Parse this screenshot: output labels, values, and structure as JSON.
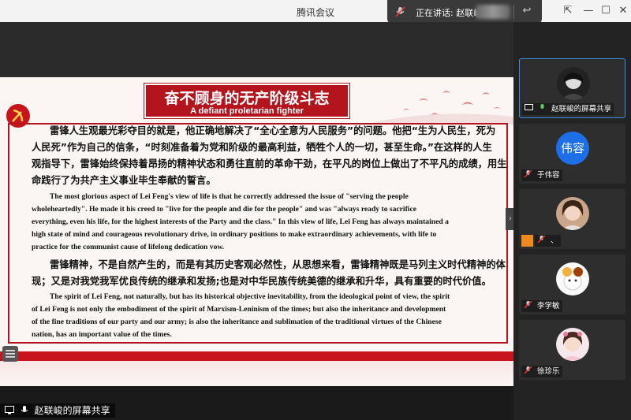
{
  "window": {
    "title": "腾讯会议"
  },
  "speaking": {
    "label": "正在讲话: 赵联峻"
  },
  "slide": {
    "title_zh": "奋不顾身的无产阶级斗志",
    "title_en": "A defiant proletarian fighter",
    "zh_para1": [
      "雷锋人生观最光彩夺目的就是，他正确地解决了“全心全意为人民服务”的问题。他把“生为人民生，死为",
      "人民死”作为自己的信条，“时刻准备着为党和阶级的最高利益，牺牲个人的一切，甚至生命。”在这样的人生",
      "观指导下，雷锋始终保持着昂扬的精神状态和勇往直前的革命干劲，在平凡的岗位上做出了不平凡的成绩，用生",
      "命践行了为共产主义事业毕生奉献的誓言。"
    ],
    "en_para1": [
      "The most glorious aspect of Lei Feng's view of life is that he correctly addressed the issue of \"serving the people",
      "wholeheartedly\". He made it his creed to \"live for the people and die for the people\" and was \"always ready to sacrifice",
      "everything, even his life, for the highest interests of the Party and the class.\" In this view of life, Lei Feng has always maintained a",
      "high state of mind and courageous revolutionary drive, in ordinary positions to make extraordinary achievements, with life to",
      "practice for the communist cause of lifelong dedication vow."
    ],
    "zh_para2": [
      "雷锋精神，不是自然产生的，而是有其历史客观必然性，从思想来看，雷锋精神既是马列主义时代精神的体",
      "现；又是对我党我军优良传统的继承和发扬;也是对中华民族传统美德的继承和升华，具有重要的时代价值。"
    ],
    "en_para2": [
      "The spirit of Lei Feng, not naturally, but has its historical objective inevitability, from the ideological point of view, the spirit",
      "of Lei Feng is not only the embodiment of the spirit of Marxism-Leninism of the times; but also the inheritance and development",
      "of the fine traditions of our party and our army; is also the inheritance and sublimation of the traditional virtues of the Chinese",
      "nation, has an important value of the times."
    ]
  },
  "share_label": "赵联峻的屏幕共享",
  "participants": [
    {
      "name": "赵联峻的屏幕共享",
      "avatar": "photo"
    },
    {
      "name": "于伟容",
      "avatar_text": "伟容"
    },
    {
      "name": "、",
      "avatar": "photo"
    },
    {
      "name": "李学敏",
      "avatar": "cartoon"
    },
    {
      "name": "徐珍乐",
      "avatar": "photo"
    }
  ],
  "colors": {
    "accent_red": "#b4141c",
    "tile_bg": "#2e2e2e",
    "active_border": "#3a8ee6",
    "avatar_blue": "#1d6fe8"
  }
}
